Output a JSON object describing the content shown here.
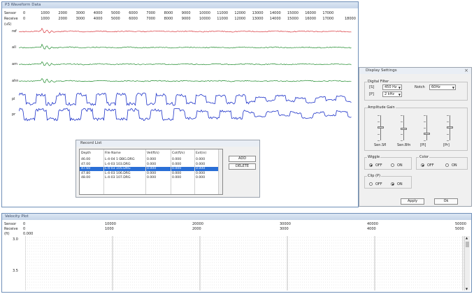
{
  "waveform_window": {
    "title": "P3 Waveform Data",
    "sensor_label": "Sensor",
    "receive_label": "Receive",
    "unit_label": "(uS)",
    "sensor_values": [
      "0",
      "1000",
      "2000",
      "3000",
      "4000",
      "5000",
      "6000",
      "7000",
      "8000",
      "9000",
      "10000",
      "11000",
      "12000",
      "13000",
      "14000",
      "15000",
      "16000",
      "17000"
    ],
    "receive_values": [
      "0",
      "1000",
      "2000",
      "3000",
      "4000",
      "5000",
      "6000",
      "7000",
      "8000",
      "9000",
      "10000",
      "11000",
      "12000",
      "13000",
      "14000",
      "15000",
      "16000",
      "17000"
    ],
    "receive_values_right": [
      "18000"
    ],
    "traces": [
      {
        "label": "ref",
        "color": "#d9343a"
      },
      {
        "label": "all",
        "color": "#1d8a2a"
      },
      {
        "label": "am",
        "color": "#1d8a2a"
      },
      {
        "label": "ahn",
        "color": "#1d8a2a"
      },
      {
        "label": "pl",
        "color": "#1f34c9"
      },
      {
        "label": "pr",
        "color": "#1f34c9"
      }
    ]
  },
  "record_list": {
    "title": "Record List",
    "columns": [
      "Depth",
      "File Name",
      "Vel(ft/s)",
      "Col(ft/s)",
      "Ext(in)"
    ],
    "rows": [
      [
        "46.00",
        "L-4-04 1-DBG.DRG",
        "0.000",
        "0.000",
        "0.000"
      ],
      [
        "47.00",
        "L-4-03 103.DRG",
        "0.000",
        "0.000",
        "0.000"
      ],
      [
        "47.60",
        "L-4-03 105.DRG",
        "0.000",
        "0.000",
        "0.000"
      ],
      [
        "47.80",
        "L-4-03 106.DRG",
        "0.000",
        "0.000",
        "0.000"
      ],
      [
        "48.00",
        "L-4-03 107.DRG",
        "0.000",
        "0.000",
        "0.000"
      ]
    ],
    "selected_index": 2,
    "add_label": "ADD",
    "delete_label": "DELETE"
  },
  "display_settings": {
    "title": "Display Settings",
    "close_glyph": "×",
    "digital_filter": {
      "group_label": "Digital Filter",
      "s_label": "[S]",
      "s_value": "450 Hz",
      "notch_label": "Notch",
      "notch_value": "60Hz",
      "p_label": "[P]",
      "p_value": "2 kHz"
    },
    "amplitude_gain": {
      "group_label": "Amplitude Gain",
      "sliders": [
        {
          "label": "Sen.Sfl",
          "level": 0.55
        },
        {
          "label": "Sen.Bfn",
          "level": 0.5
        },
        {
          "label": "[Pl]",
          "level": 0.3
        },
        {
          "label": "[Pr]",
          "level": 0.55
        }
      ]
    },
    "wiggle": {
      "group_label": "Wiggle",
      "off_label": "OFF",
      "on_label": "ON",
      "selected": "OFF"
    },
    "color": {
      "group_label": "Color",
      "off_label": "OFF",
      "on_label": "ON",
      "selected": "OFF"
    },
    "clip": {
      "group_label": "Clip (P)",
      "off_label": "OFF",
      "on_label": "ON",
      "selected": "ON"
    },
    "apply_label": "Apply",
    "ok_label": "Ok"
  },
  "velocity_window": {
    "title": "Velocity Plot",
    "sensor_label": "Sensor",
    "receive_label": "Receive",
    "unit_label": "(ft)",
    "sensor_values": [
      "0",
      "10000",
      "20000",
      "30000",
      "40000",
      "50000"
    ],
    "receive_values": [
      "0",
      "1000",
      "2000",
      "3000",
      "4000",
      "5000"
    ],
    "depth_start": "0.000",
    "row_labels": [
      "3.0",
      "3.5"
    ]
  }
}
